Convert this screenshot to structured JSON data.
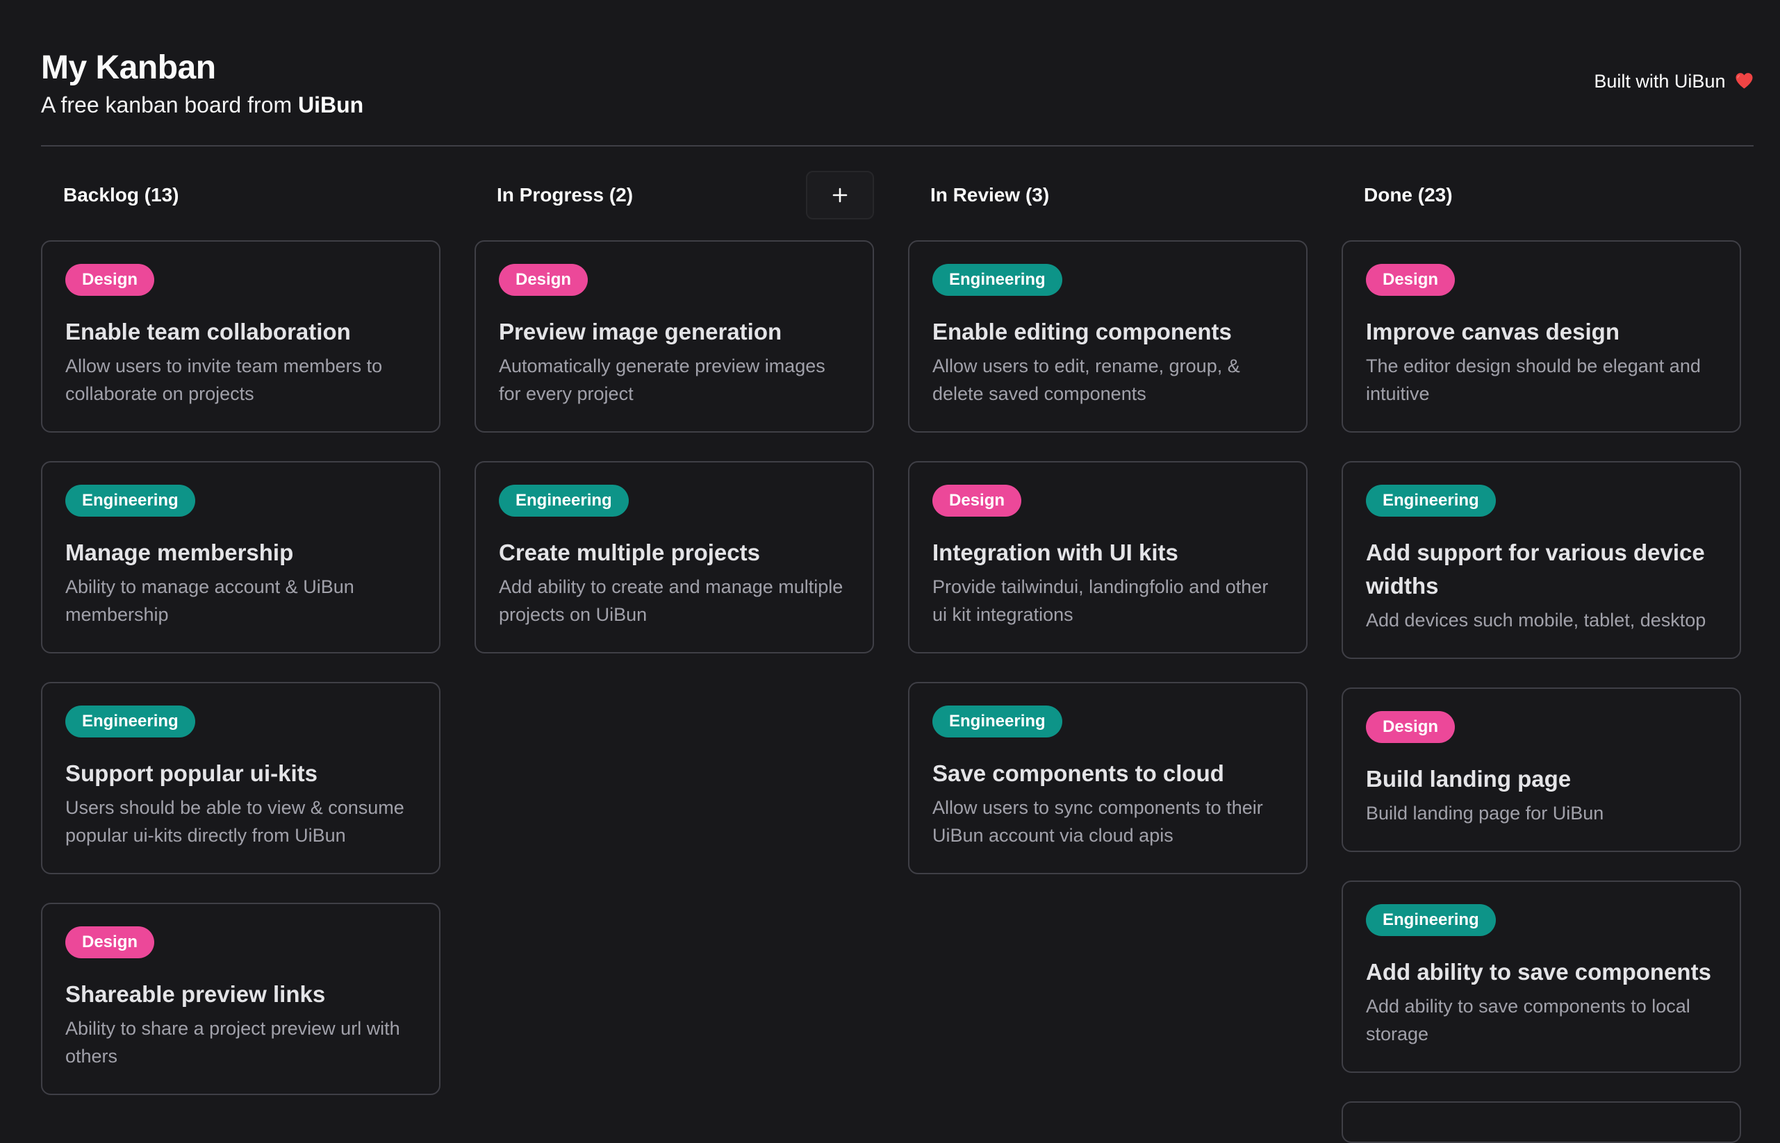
{
  "header": {
    "title": "My Kanban",
    "subtitle_prefix": "A free kanban board from ",
    "subtitle_brand": "UiBun",
    "built_with": "Built with UiBun",
    "built_with_icon": "heart-icon"
  },
  "colors": {
    "background": "#18181b",
    "card_border": "#3f3f46",
    "design_tag": "#ec4899",
    "engineering_tag": "#0d9488",
    "heart": "#ef4444"
  },
  "columns": [
    {
      "title": "Backlog (13)",
      "cards": [
        {
          "tag": "Design",
          "title": "Enable team collaboration",
          "description": "Allow users to invite team members to collaborate on projects"
        },
        {
          "tag": "Engineering",
          "title": "Manage membership",
          "description": "Ability to manage account & UiBun membership"
        },
        {
          "tag": "Engineering",
          "title": "Support popular ui-kits",
          "description": "Users should be able to view & consume popular ui-kits directly from UiBun"
        },
        {
          "tag": "Design",
          "title": "Shareable preview links",
          "description": "Ability to share a project preview url with others"
        }
      ]
    },
    {
      "title": "In Progress (2)",
      "add_button_label": "+",
      "cards": [
        {
          "tag": "Design",
          "title": "Preview image generation",
          "description": "Automatically generate preview images for every project"
        },
        {
          "tag": "Engineering",
          "title": "Create multiple projects",
          "description": "Add ability to create and manage multiple projects on UiBun"
        }
      ]
    },
    {
      "title": "In Review (3)",
      "cards": [
        {
          "tag": "Engineering",
          "title": "Enable editing components",
          "description": "Allow users to edit, rename, group, & delete saved components"
        },
        {
          "tag": "Design",
          "title": "Integration with UI kits",
          "description": "Provide tailwindui, landingfolio and other ui kit integrations"
        },
        {
          "tag": "Engineering",
          "title": "Save components to cloud",
          "description": "Allow users to sync components to their UiBun account via cloud apis"
        }
      ]
    },
    {
      "title": "Done (23)",
      "cards": [
        {
          "tag": "Design",
          "title": "Improve canvas design",
          "description": "The editor design should be elegant and intuitive"
        },
        {
          "tag": "Engineering",
          "title": "Add support for various device widths",
          "description": "Add devices such mobile, tablet, desktop"
        },
        {
          "tag": "Design",
          "title": "Build landing page",
          "description": "Build landing page for UiBun"
        },
        {
          "tag": "Engineering",
          "title": "Add ability to save components",
          "description": "Add ability to save components to local storage"
        }
      ]
    }
  ]
}
